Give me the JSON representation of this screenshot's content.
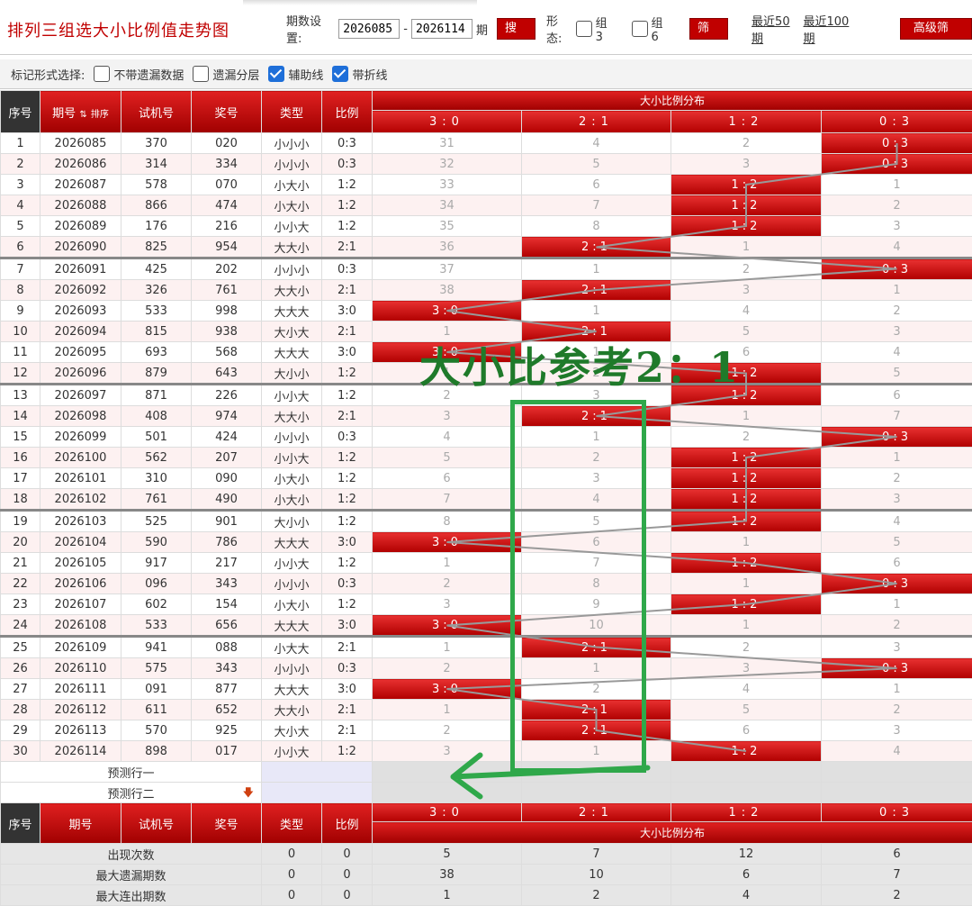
{
  "page_title": "排列三组选大小比例值走势图",
  "filters": {
    "period_label": "期数设置:",
    "start_value": "2026085",
    "dash": "-",
    "end_value": "2026114",
    "period_unit": "期",
    "search_label": "搜索",
    "shape_label": "形态:",
    "group3_label": "组3",
    "group6_label": "组6",
    "filter_label": "筛选",
    "recent50": "最近50期",
    "recent100": "最近100期",
    "advanced_label": "高级筛选"
  },
  "marks": {
    "label": "标记形式选择:",
    "opt1": "不带遗漏数据",
    "opt2": "遗漏分层",
    "opt3": "辅助线",
    "opt4": "带折线"
  },
  "table": {
    "col_seq": "序号",
    "col_period": "期号",
    "col_sort": "排序",
    "col_trial": "试机号",
    "col_prize": "奖号",
    "col_type": "类型",
    "col_ratio": "比例",
    "dist_title": "大小比例分布",
    "dist_cols": [
      "3:0",
      "2:1",
      "1:2",
      "0:3"
    ],
    "rows": [
      {
        "seq": "1",
        "period": "2026085",
        "trial": "370",
        "prize": "020",
        "type": "小小小",
        "ratio": "0:3",
        "dist": [
          "31",
          "4",
          "2",
          "0:3"
        ]
      },
      {
        "seq": "2",
        "period": "2026086",
        "trial": "314",
        "prize": "334",
        "type": "小小小",
        "ratio": "0:3",
        "dist": [
          "32",
          "5",
          "3",
          "0:3"
        ]
      },
      {
        "seq": "3",
        "period": "2026087",
        "trial": "578",
        "prize": "070",
        "type": "小大小",
        "ratio": "1:2",
        "dist": [
          "33",
          "6",
          "1:2",
          "1"
        ]
      },
      {
        "seq": "4",
        "period": "2026088",
        "trial": "866",
        "prize": "474",
        "type": "小大小",
        "ratio": "1:2",
        "dist": [
          "34",
          "7",
          "1:2",
          "2"
        ]
      },
      {
        "seq": "5",
        "period": "2026089",
        "trial": "176",
        "prize": "216",
        "type": "小小大",
        "ratio": "1:2",
        "dist": [
          "35",
          "8",
          "1:2",
          "3"
        ]
      },
      {
        "seq": "6",
        "period": "2026090",
        "trial": "825",
        "prize": "954",
        "type": "大大小",
        "ratio": "2:1",
        "dist": [
          "36",
          "2:1",
          "1",
          "4"
        ]
      },
      {
        "seq": "7",
        "period": "2026091",
        "trial": "425",
        "prize": "202",
        "type": "小小小",
        "ratio": "0:3",
        "dist": [
          "37",
          "1",
          "2",
          "0:3"
        ]
      },
      {
        "seq": "8",
        "period": "2026092",
        "trial": "326",
        "prize": "761",
        "type": "大大小",
        "ratio": "2:1",
        "dist": [
          "38",
          "2:1",
          "3",
          "1"
        ]
      },
      {
        "seq": "9",
        "period": "2026093",
        "trial": "533",
        "prize": "998",
        "type": "大大大",
        "ratio": "3:0",
        "dist": [
          "3:0",
          "1",
          "4",
          "2"
        ]
      },
      {
        "seq": "10",
        "period": "2026094",
        "trial": "815",
        "prize": "938",
        "type": "大小大",
        "ratio": "2:1",
        "dist": [
          "1",
          "2:1",
          "5",
          "3"
        ]
      },
      {
        "seq": "11",
        "period": "2026095",
        "trial": "693",
        "prize": "568",
        "type": "大大大",
        "ratio": "3:0",
        "dist": [
          "3:0",
          "1",
          "6",
          "4"
        ]
      },
      {
        "seq": "12",
        "period": "2026096",
        "trial": "879",
        "prize": "643",
        "type": "大小小",
        "ratio": "1:2",
        "dist": [
          "1",
          "2",
          "1:2",
          "5"
        ]
      },
      {
        "seq": "13",
        "period": "2026097",
        "trial": "871",
        "prize": "226",
        "type": "小小大",
        "ratio": "1:2",
        "dist": [
          "2",
          "3",
          "1:2",
          "6"
        ]
      },
      {
        "seq": "14",
        "period": "2026098",
        "trial": "408",
        "prize": "974",
        "type": "大大小",
        "ratio": "2:1",
        "dist": [
          "3",
          "2:1",
          "1",
          "7"
        ]
      },
      {
        "seq": "15",
        "period": "2026099",
        "trial": "501",
        "prize": "424",
        "type": "小小小",
        "ratio": "0:3",
        "dist": [
          "4",
          "1",
          "2",
          "0:3"
        ]
      },
      {
        "seq": "16",
        "period": "2026100",
        "trial": "562",
        "prize": "207",
        "type": "小小大",
        "ratio": "1:2",
        "dist": [
          "5",
          "2",
          "1:2",
          "1"
        ]
      },
      {
        "seq": "17",
        "period": "2026101",
        "trial": "310",
        "prize": "090",
        "type": "小大小",
        "ratio": "1:2",
        "dist": [
          "6",
          "3",
          "1:2",
          "2"
        ]
      },
      {
        "seq": "18",
        "period": "2026102",
        "trial": "761",
        "prize": "490",
        "type": "小大小",
        "ratio": "1:2",
        "dist": [
          "7",
          "4",
          "1:2",
          "3"
        ]
      },
      {
        "seq": "19",
        "period": "2026103",
        "trial": "525",
        "prize": "901",
        "type": "大小小",
        "ratio": "1:2",
        "dist": [
          "8",
          "5",
          "1:2",
          "4"
        ]
      },
      {
        "seq": "20",
        "period": "2026104",
        "trial": "590",
        "prize": "786",
        "type": "大大大",
        "ratio": "3:0",
        "dist": [
          "3:0",
          "6",
          "1",
          "5"
        ]
      },
      {
        "seq": "21",
        "period": "2026105",
        "trial": "917",
        "prize": "217",
        "type": "小小大",
        "ratio": "1:2",
        "dist": [
          "1",
          "7",
          "1:2",
          "6"
        ]
      },
      {
        "seq": "22",
        "period": "2026106",
        "trial": "096",
        "prize": "343",
        "type": "小小小",
        "ratio": "0:3",
        "dist": [
          "2",
          "8",
          "1",
          "0:3"
        ]
      },
      {
        "seq": "23",
        "period": "2026107",
        "trial": "602",
        "prize": "154",
        "type": "小大小",
        "ratio": "1:2",
        "dist": [
          "3",
          "9",
          "1:2",
          "1"
        ]
      },
      {
        "seq": "24",
        "period": "2026108",
        "trial": "533",
        "prize": "656",
        "type": "大大大",
        "ratio": "3:0",
        "dist": [
          "3:0",
          "10",
          "1",
          "2"
        ]
      },
      {
        "seq": "25",
        "period": "2026109",
        "trial": "941",
        "prize": "088",
        "type": "小大大",
        "ratio": "2:1",
        "dist": [
          "1",
          "2:1",
          "2",
          "3"
        ]
      },
      {
        "seq": "26",
        "period": "2026110",
        "trial": "575",
        "prize": "343",
        "type": "小小小",
        "ratio": "0:3",
        "dist": [
          "2",
          "1",
          "3",
          "0:3"
        ]
      },
      {
        "seq": "27",
        "period": "2026111",
        "trial": "091",
        "prize": "877",
        "type": "大大大",
        "ratio": "3:0",
        "dist": [
          "3:0",
          "2",
          "4",
          "1"
        ]
      },
      {
        "seq": "28",
        "period": "2026112",
        "trial": "611",
        "prize": "652",
        "type": "大大小",
        "ratio": "2:1",
        "dist": [
          "1",
          "2:1",
          "5",
          "2"
        ]
      },
      {
        "seq": "29",
        "period": "2026113",
        "trial": "570",
        "prize": "925",
        "type": "大小大",
        "ratio": "2:1",
        "dist": [
          "2",
          "2:1",
          "6",
          "3"
        ]
      },
      {
        "seq": "30",
        "period": "2026114",
        "trial": "898",
        "prize": "017",
        "type": "小小大",
        "ratio": "1:2",
        "dist": [
          "3",
          "1",
          "1:2",
          "4"
        ]
      }
    ],
    "predict1": "预测行一",
    "predict2": "预测行二",
    "stats": [
      {
        "label": "出现次数",
        "type": "0",
        "ratio": "0",
        "vals": [
          "5",
          "7",
          "12",
          "6"
        ]
      },
      {
        "label": "最大遗漏期数",
        "type": "0",
        "ratio": "0",
        "vals": [
          "38",
          "10",
          "6",
          "7"
        ]
      },
      {
        "label": "最大连出期数",
        "type": "0",
        "ratio": "0",
        "vals": [
          "1",
          "2",
          "4",
          "2"
        ]
      }
    ]
  },
  "annotation": {
    "text": "大小比参考2：1",
    "color": "#1f7a2a"
  },
  "colors": {
    "brand_red": "#c00000",
    "accent_green": "#2fa84a",
    "checkbox_blue": "#1e6fd9"
  }
}
